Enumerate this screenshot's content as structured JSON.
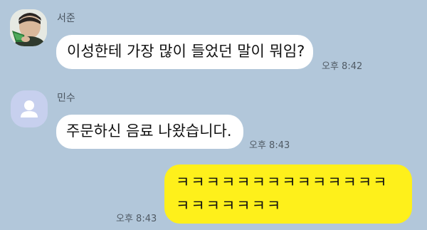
{
  "messages": [
    {
      "sender": "서준",
      "avatar": "profile-photo",
      "text": "이성한테 가장 많이 들었던 말이 뭐임?",
      "time": "오후 8:42",
      "direction": "incoming"
    },
    {
      "sender": "민수",
      "avatar": "default-person-icon",
      "text": "주문하신 음료 나왔습니다.",
      "time": "오후 8:43",
      "direction": "incoming"
    },
    {
      "sender": "",
      "text": "ㅋㅋㅋㅋㅋㅋㅋㅋㅋㅋㅋㅋㅋㅋㅋㅋㅋㅋㅋㅋㅋ",
      "time": "오후 8:43",
      "direction": "outgoing"
    }
  ],
  "colors": {
    "background": "#b2c7da",
    "incoming_bubble": "#ffffff",
    "outgoing_bubble": "#fef01b",
    "default_avatar": "#c7d0ee"
  }
}
